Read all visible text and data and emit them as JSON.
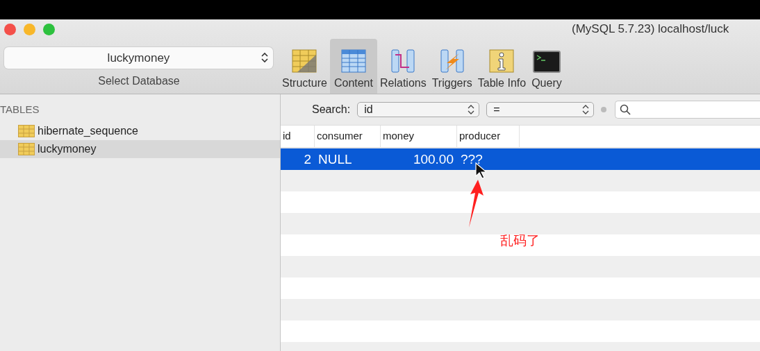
{
  "window": {
    "title": "(MySQL 5.7.23) localhost/luck"
  },
  "database_selector": {
    "value": "luckymoney",
    "caption": "Select Database"
  },
  "toolbar": [
    {
      "label": "Structure",
      "kind": "structure",
      "selected": false
    },
    {
      "label": "Content",
      "kind": "content",
      "selected": true
    },
    {
      "label": "Relations",
      "kind": "relations",
      "selected": false
    },
    {
      "label": "Triggers",
      "kind": "triggers",
      "selected": false
    },
    {
      "label": "Table Info",
      "kind": "info",
      "selected": false
    },
    {
      "label": "Query",
      "kind": "query",
      "selected": false
    }
  ],
  "sidebar": {
    "heading": "TABLES",
    "items": [
      {
        "label": "hibernate_sequence",
        "selected": false
      },
      {
        "label": "luckymoney",
        "selected": true
      }
    ]
  },
  "search": {
    "label": "Search:",
    "field": "id",
    "operator": "="
  },
  "table": {
    "columns": [
      "id",
      "consumer",
      "money",
      "producer"
    ],
    "rows": [
      {
        "cells": [
          "2",
          "NULL",
          "100.00",
          "???"
        ],
        "selected": true
      }
    ]
  },
  "annotation": {
    "text": "乱码了"
  }
}
